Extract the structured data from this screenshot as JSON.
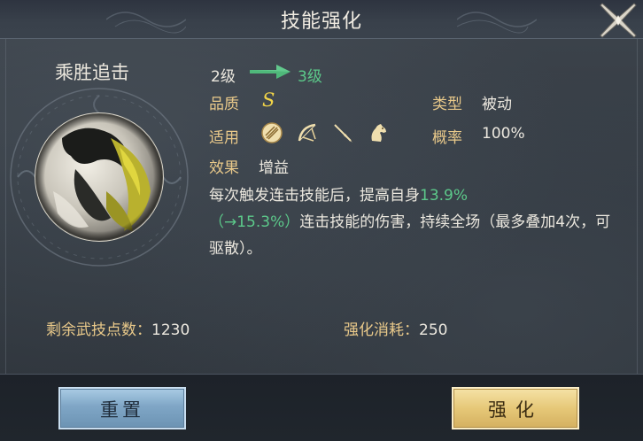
{
  "header": {
    "title": "技能强化"
  },
  "skill": {
    "name": "乘胜追击",
    "level_from": "2级",
    "level_to": "3级",
    "quality_label": "品质",
    "quality_value": "S",
    "type_label": "类型",
    "type_value": "被动",
    "apply_label": "适用",
    "apply_icons": [
      "staff-icon",
      "bow-icon",
      "spear-icon",
      "horse-icon"
    ],
    "chance_label": "概率",
    "chance_value": "100%",
    "effect_label": "效果",
    "effect_value": "增益",
    "desc_part1": "每次触发连击技能后，提高自身",
    "desc_value": "13.9%",
    "desc_next": "（→15.3%）",
    "desc_part2": "连击技能的伤害，持续全场（最多叠加4次，可驱散）。"
  },
  "stats": {
    "points_label": "剩余武技点数：",
    "points_value": "1230",
    "cost_label": "强化消耗：",
    "cost_value": "250"
  },
  "buttons": {
    "reset": "重置",
    "enhance": "强化"
  },
  "colors": {
    "label": "#e9c98a",
    "highlight": "#5cc98a",
    "quality": "#f3d548",
    "reset_button": "#7fa6c6",
    "enhance_button": "#e6c878"
  }
}
